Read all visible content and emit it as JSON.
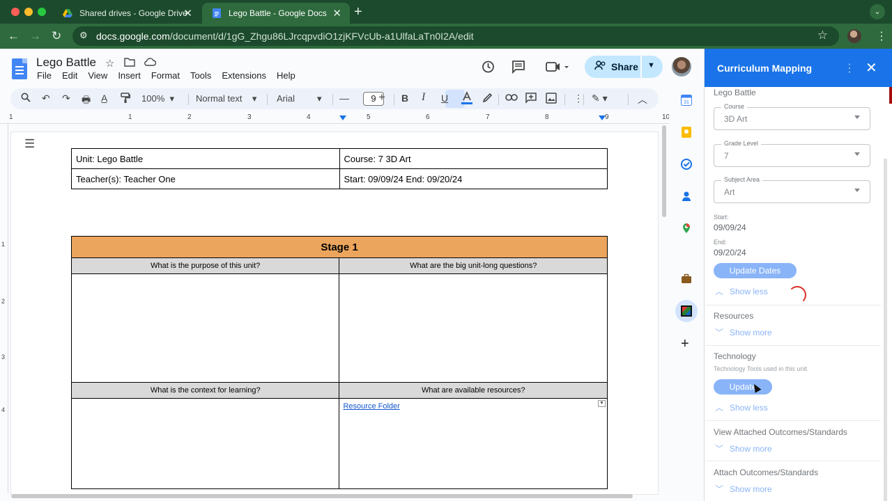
{
  "browser": {
    "tabs": [
      {
        "title": "Shared drives - Google Drive",
        "active": false
      },
      {
        "title": "Lego Battle - Google Docs",
        "active": true
      }
    ],
    "url_host": "docs.google.com",
    "url_path": "/document/d/1gG_Zhgu86LJrcqpvdiO1zjKFVcUb-a1UlfaLaTn0I2A/edit"
  },
  "docs": {
    "title": "Lego Battle",
    "menu": [
      "File",
      "Edit",
      "View",
      "Insert",
      "Format",
      "Tools",
      "Extensions",
      "Help"
    ],
    "share_label": "Share",
    "toolbar": {
      "zoom": "100%",
      "style": "Normal text",
      "font": "Arial",
      "font_size": "9"
    },
    "ruler_numbers": [
      "1",
      "1",
      "2",
      "3",
      "4",
      "5",
      "6",
      "7",
      "8",
      "9",
      "10"
    ],
    "vruler_numbers": [
      "1",
      "2",
      "3",
      "4"
    ]
  },
  "document": {
    "info": {
      "unit": "Unit: Lego Battle",
      "course": "Course: 7 3D Art",
      "teacher": "Teacher(s): Teacher One",
      "dates": "Start: 09/09/24 End: 09/20/24"
    },
    "stage": {
      "title": "Stage 1",
      "q1": "What is the purpose of this unit?",
      "q2": "What are the big unit-long questions?",
      "q3": "What is the context for learning?",
      "q4": "What are available resources?",
      "resource_link": "Resource Folder"
    }
  },
  "panel": {
    "title": "Curriculum Mapping",
    "unit_name": "Lego Battle",
    "course_label": "Course",
    "course_value": "3D Art",
    "grade_label": "Grade Level",
    "grade_value": "7",
    "subject_label": "Subject Area",
    "subject_value": "Art",
    "start_label": "Start:",
    "start_value": "09/09/24",
    "end_label": "End:",
    "end_value": "09/20/24",
    "update_dates": "Update Dates",
    "show_less": "Show less",
    "show_more": "Show more",
    "resources_title": "Resources",
    "technology_title": "Technology",
    "technology_desc": "Technology Tools used in this unit.",
    "update_btn": "Update",
    "view_outcomes_title": "View Attached Outcomes/Standards",
    "attach_outcomes_title": "Attach Outcomes/Standards"
  },
  "colors": {
    "stage_header": "#eca55d",
    "panel_header": "#1a73e8",
    "chrome_dark": "#1c4a2c",
    "chrome": "#2e6a3d"
  }
}
